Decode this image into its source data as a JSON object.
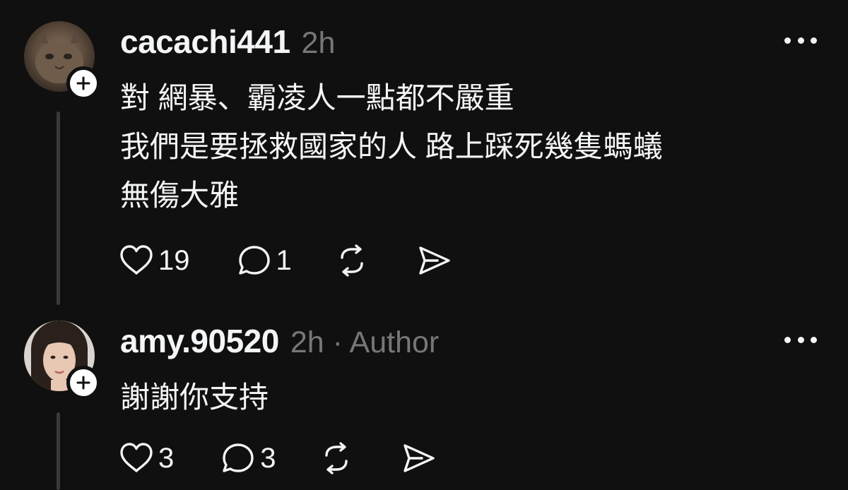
{
  "comments": [
    {
      "username": "cacachi441",
      "meta": "2h",
      "avatar": "cat-photo-avatar",
      "lines": [
        "對 網暴、霸凌人一點都不嚴重",
        "我們是要拯救國家的人 路上踩死幾隻螞蟻",
        "無傷大雅"
      ],
      "likes": "19",
      "replies": "1"
    },
    {
      "username": "amy.90520",
      "meta": "2h · Author",
      "avatar": "woman-photo-avatar",
      "lines": [
        "謝謝你支持"
      ],
      "likes": "3",
      "replies": "3"
    }
  ],
  "icons": {
    "like": "heart-icon",
    "reply": "comment-bubble-icon",
    "repost": "repost-icon",
    "share": "send-icon",
    "more": "more-dots-icon",
    "follow": "plus-icon"
  },
  "colors": {
    "background": "#101010",
    "text": "#f3f5f7",
    "secondary": "#777777",
    "thread_line": "#3a3a3a"
  }
}
